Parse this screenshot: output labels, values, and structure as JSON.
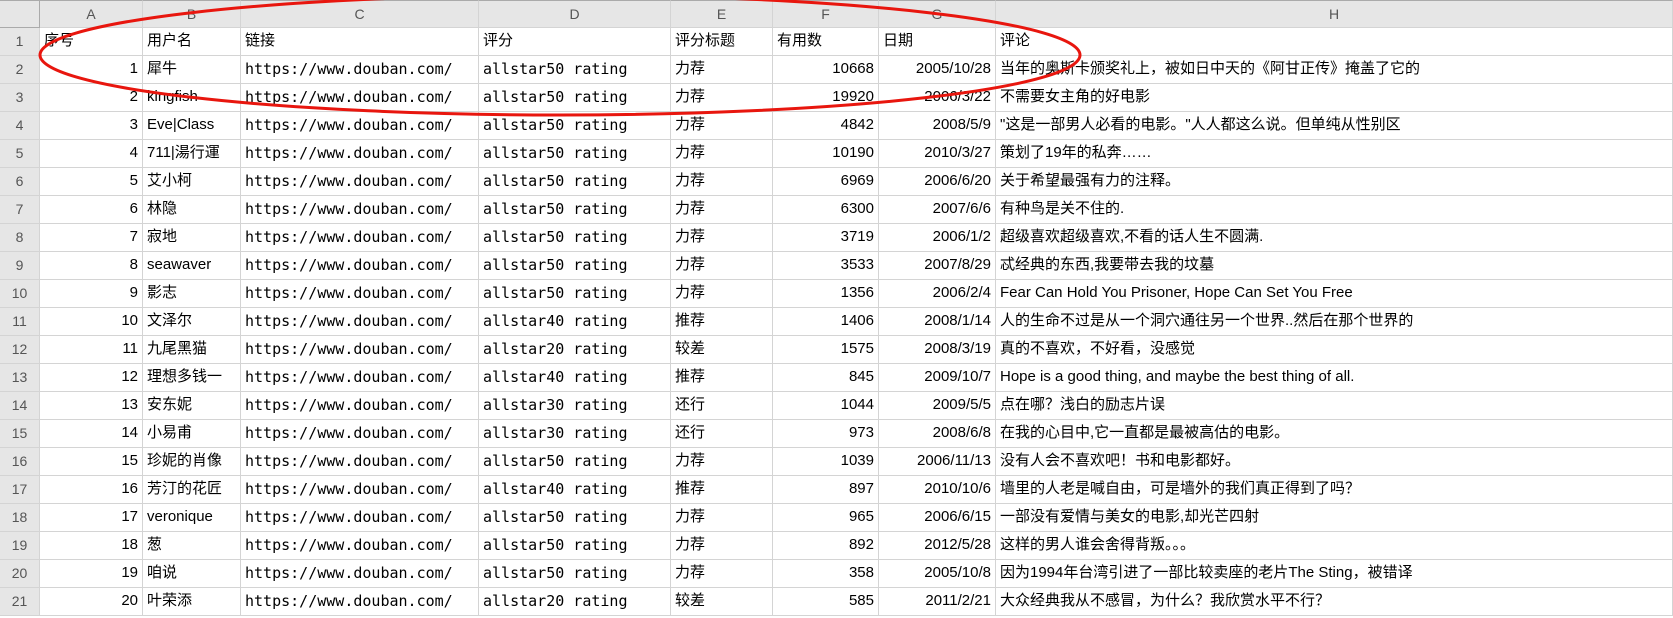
{
  "columns": [
    "A",
    "B",
    "C",
    "D",
    "E",
    "F",
    "G",
    "H"
  ],
  "row_numbers": [
    1,
    2,
    3,
    4,
    5,
    6,
    7,
    8,
    9,
    10,
    11,
    12,
    13,
    14,
    15,
    16,
    17,
    18,
    19,
    20,
    21
  ],
  "headers": {
    "seq": "序号",
    "user": "用户名",
    "link": "链接",
    "rating_class": "评分",
    "rating_title": "评分标题",
    "useful": "有用数",
    "date": "日期",
    "comment": "评论"
  },
  "rows": [
    {
      "seq": "1",
      "user": "犀牛",
      "link": "https://www.douban.com/",
      "rating_class": "allstar50 rating",
      "rating_title": "力荐",
      "useful": "10668",
      "date": "2005/10/28",
      "comment": "当年的奥斯卡颁奖礼上，被如日中天的《阿甘正传》掩盖了它的"
    },
    {
      "seq": "2",
      "user": "kingfish",
      "link": "https://www.douban.com/",
      "rating_class": "allstar50 rating",
      "rating_title": "力荐",
      "useful": "19920",
      "date": "2006/3/22",
      "comment": "不需要女主角的好电影"
    },
    {
      "seq": "3",
      "user": "Eve|Class",
      "link": "https://www.douban.com/",
      "rating_class": "allstar50 rating",
      "rating_title": "力荐",
      "useful": "4842",
      "date": "2008/5/9",
      "comment": "\"这是一部男人必看的电影。\"人人都这么说。但单纯从性别区"
    },
    {
      "seq": "4",
      "user": "711|湯行運",
      "link": "https://www.douban.com/",
      "rating_class": "allstar50 rating",
      "rating_title": "力荐",
      "useful": "10190",
      "date": "2010/3/27",
      "comment": "策划了19年的私奔……"
    },
    {
      "seq": "5",
      "user": "艾小柯",
      "link": "https://www.douban.com/",
      "rating_class": "allstar50 rating",
      "rating_title": "力荐",
      "useful": "6969",
      "date": "2006/6/20",
      "comment": "关于希望最强有力的注释。"
    },
    {
      "seq": "6",
      "user": "林隐",
      "link": "https://www.douban.com/",
      "rating_class": "allstar50 rating",
      "rating_title": "力荐",
      "useful": "6300",
      "date": "2007/6/6",
      "comment": "有种鸟是关不住的."
    },
    {
      "seq": "7",
      "user": "寂地",
      "link": "https://www.douban.com/",
      "rating_class": "allstar50 rating",
      "rating_title": "力荐",
      "useful": "3719",
      "date": "2006/1/2",
      "comment": "超级喜欢超级喜欢,不看的话人生不圆满."
    },
    {
      "seq": "8",
      "user": "seawaver",
      "link": "https://www.douban.com/",
      "rating_class": "allstar50 rating",
      "rating_title": "力荐",
      "useful": "3533",
      "date": "2007/8/29",
      "comment": "忒经典的东西,我要带去我的坟墓"
    },
    {
      "seq": "9",
      "user": "影志",
      "link": "https://www.douban.com/",
      "rating_class": "allstar50 rating",
      "rating_title": "力荐",
      "useful": "1356",
      "date": "2006/2/4",
      "comment": "Fear Can Hold You Prisoner, Hope Can Set You Free"
    },
    {
      "seq": "10",
      "user": "文泽尔",
      "link": "https://www.douban.com/",
      "rating_class": "allstar40 rating",
      "rating_title": "推荐",
      "useful": "1406",
      "date": "2008/1/14",
      "comment": "人的生命不过是从一个洞穴通往另一个世界..然后在那个世界的"
    },
    {
      "seq": "11",
      "user": "九尾黑猫",
      "link": "https://www.douban.com/",
      "rating_class": "allstar20 rating",
      "rating_title": "较差",
      "useful": "1575",
      "date": "2008/3/19",
      "comment": "真的不喜欢，不好看，没感觉"
    },
    {
      "seq": "12",
      "user": "理想多钱一",
      "link": "https://www.douban.com/",
      "rating_class": "allstar40 rating",
      "rating_title": "推荐",
      "useful": "845",
      "date": "2009/10/7",
      "comment": "Hope is a good thing, and maybe the best thing of all."
    },
    {
      "seq": "13",
      "user": "安东妮",
      "link": "https://www.douban.com/",
      "rating_class": "allstar30 rating",
      "rating_title": "还行",
      "useful": "1044",
      "date": "2009/5/5",
      "comment": "点在哪？浅白的励志片误"
    },
    {
      "seq": "14",
      "user": "小易甫",
      "link": "https://www.douban.com/",
      "rating_class": "allstar30 rating",
      "rating_title": "还行",
      "useful": "973",
      "date": "2008/6/8",
      "comment": "在我的心目中,它一直都是最被高估的电影。"
    },
    {
      "seq": "15",
      "user": "珍妮的肖像",
      "link": "https://www.douban.com/",
      "rating_class": "allstar50 rating",
      "rating_title": "力荐",
      "useful": "1039",
      "date": "2006/11/13",
      "comment": "没有人会不喜欢吧！书和电影都好。"
    },
    {
      "seq": "16",
      "user": "芳汀的花匠",
      "link": "https://www.douban.com/",
      "rating_class": "allstar40 rating",
      "rating_title": "推荐",
      "useful": "897",
      "date": "2010/10/6",
      "comment": "墙里的人老是喊自由，可是墙外的我们真正得到了吗？"
    },
    {
      "seq": "17",
      "user": "veronique",
      "link": "https://www.douban.com/",
      "rating_class": "allstar50 rating",
      "rating_title": "力荐",
      "useful": "965",
      "date": "2006/6/15",
      "comment": "一部没有爱情与美女的电影,却光芒四射"
    },
    {
      "seq": "18",
      "user": "葱",
      "link": "https://www.douban.com/",
      "rating_class": "allstar50 rating",
      "rating_title": "力荐",
      "useful": "892",
      "date": "2012/5/28",
      "comment": "这样的男人谁会舍得背叛。。。"
    },
    {
      "seq": "19",
      "user": "咱说",
      "link": "https://www.douban.com/",
      "rating_class": "allstar50 rating",
      "rating_title": "力荐",
      "useful": "358",
      "date": "2005/10/8",
      "comment": "因为1994年台湾引进了一部比较卖座的老片The Sting，被错译"
    },
    {
      "seq": "20",
      "user": "叶荣添",
      "link": "https://www.douban.com/",
      "rating_class": "allstar20 rating",
      "rating_title": "较差",
      "useful": "585",
      "date": "2011/2/21",
      "comment": "大众经典我从不感冒，为什么？我欣赏水平不行？"
    }
  ],
  "annotation": {
    "stroke": "#e8160e",
    "stroke_width": 2
  }
}
